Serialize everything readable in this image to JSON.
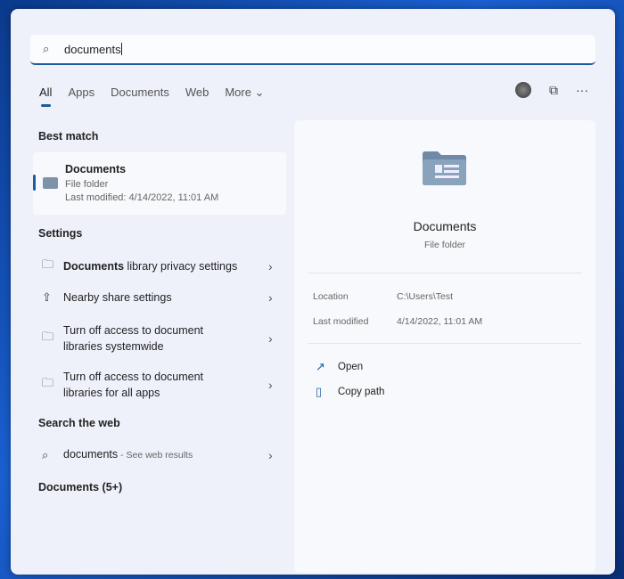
{
  "search": {
    "value": "documents"
  },
  "tabs": [
    {
      "label": "All"
    },
    {
      "label": "Apps"
    },
    {
      "label": "Documents"
    },
    {
      "label": "Web"
    },
    {
      "label": "More ⌄"
    }
  ],
  "sections": {
    "best_match": "Best match",
    "settings": "Settings",
    "search_web": "Search the web",
    "documents_more": "Documents (5+)"
  },
  "best_match": {
    "title": "Documents",
    "type": "File folder",
    "modified": "Last modified: 4/14/2022, 11:01 AM"
  },
  "settings": [
    {
      "bold": "Documents",
      "rest": " library privacy settings"
    },
    {
      "bold": "",
      "rest": "Nearby share settings"
    },
    {
      "bold": "",
      "rest": "Turn off access to document libraries systemwide"
    },
    {
      "bold": "",
      "rest": "Turn off access to document libraries for all apps"
    }
  ],
  "web": {
    "query": "documents",
    "hint": " - See web results"
  },
  "detail": {
    "title": "Documents",
    "type": "File folder",
    "location_label": "Location",
    "location": "C:\\Users\\Test",
    "modified_label": "Last modified",
    "modified": "4/14/2022, 11:01 AM",
    "actions": [
      {
        "label": "Open"
      },
      {
        "label": "Copy path"
      }
    ]
  }
}
